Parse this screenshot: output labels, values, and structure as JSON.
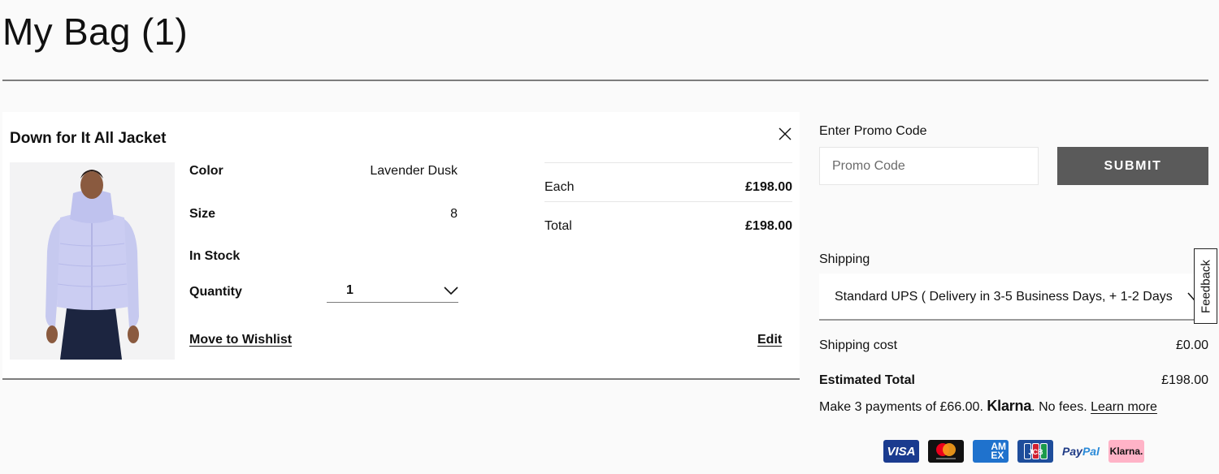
{
  "page": {
    "title": "My Bag (1)"
  },
  "item": {
    "name": "Down for It All Jacket",
    "image_alt": "Woman wearing lavender down jacket",
    "attributes": [
      {
        "label": "Color",
        "value": "Lavender Dusk"
      },
      {
        "label": "Size",
        "value": "8"
      },
      {
        "label": "In Stock",
        "value": ""
      }
    ],
    "quantity_label": "Quantity",
    "quantity_value": "1",
    "move_to_wishlist": "Move to Wishlist",
    "edit": "Edit",
    "prices": [
      {
        "label": "Each",
        "value": "£198.00"
      },
      {
        "label": "Total",
        "value": "£198.00"
      }
    ],
    "icons": {
      "close": "close-icon",
      "quantity": "chevron-down-icon"
    }
  },
  "summary": {
    "promo_label": "Enter Promo Code",
    "promo_placeholder": "Promo Code",
    "promo_value": "",
    "submit_label": "SUBMIT",
    "shipping_label": "Shipping",
    "shipping_selected": "Standard UPS ( Delivery in 3-5 Business Days, + 1-2 Days",
    "shipping_cost_label": "Shipping cost",
    "shipping_cost_value": "£0.00",
    "estimated_total_label": "Estimated Total",
    "estimated_total_value": "£198.00",
    "klarna": {
      "prefix": "Make 3 payments of £66.00. ",
      "brand": "Klarna",
      "suffix": ". No fees. ",
      "link": "Learn more"
    }
  },
  "payment_methods": [
    {
      "name": "VISA"
    },
    {
      "name": "mastercard"
    },
    {
      "name": "AMEX"
    },
    {
      "name": "JCB"
    },
    {
      "name": "PayPal"
    },
    {
      "name": "Klarna."
    }
  ],
  "feedback_tab": "Feedback",
  "colors": {
    "background": "#fafafa",
    "card": "#ffffff",
    "submit_button": "#5a5a5a",
    "divider": "#7d7d7d",
    "klarna_pink": "#ffb3c7"
  }
}
